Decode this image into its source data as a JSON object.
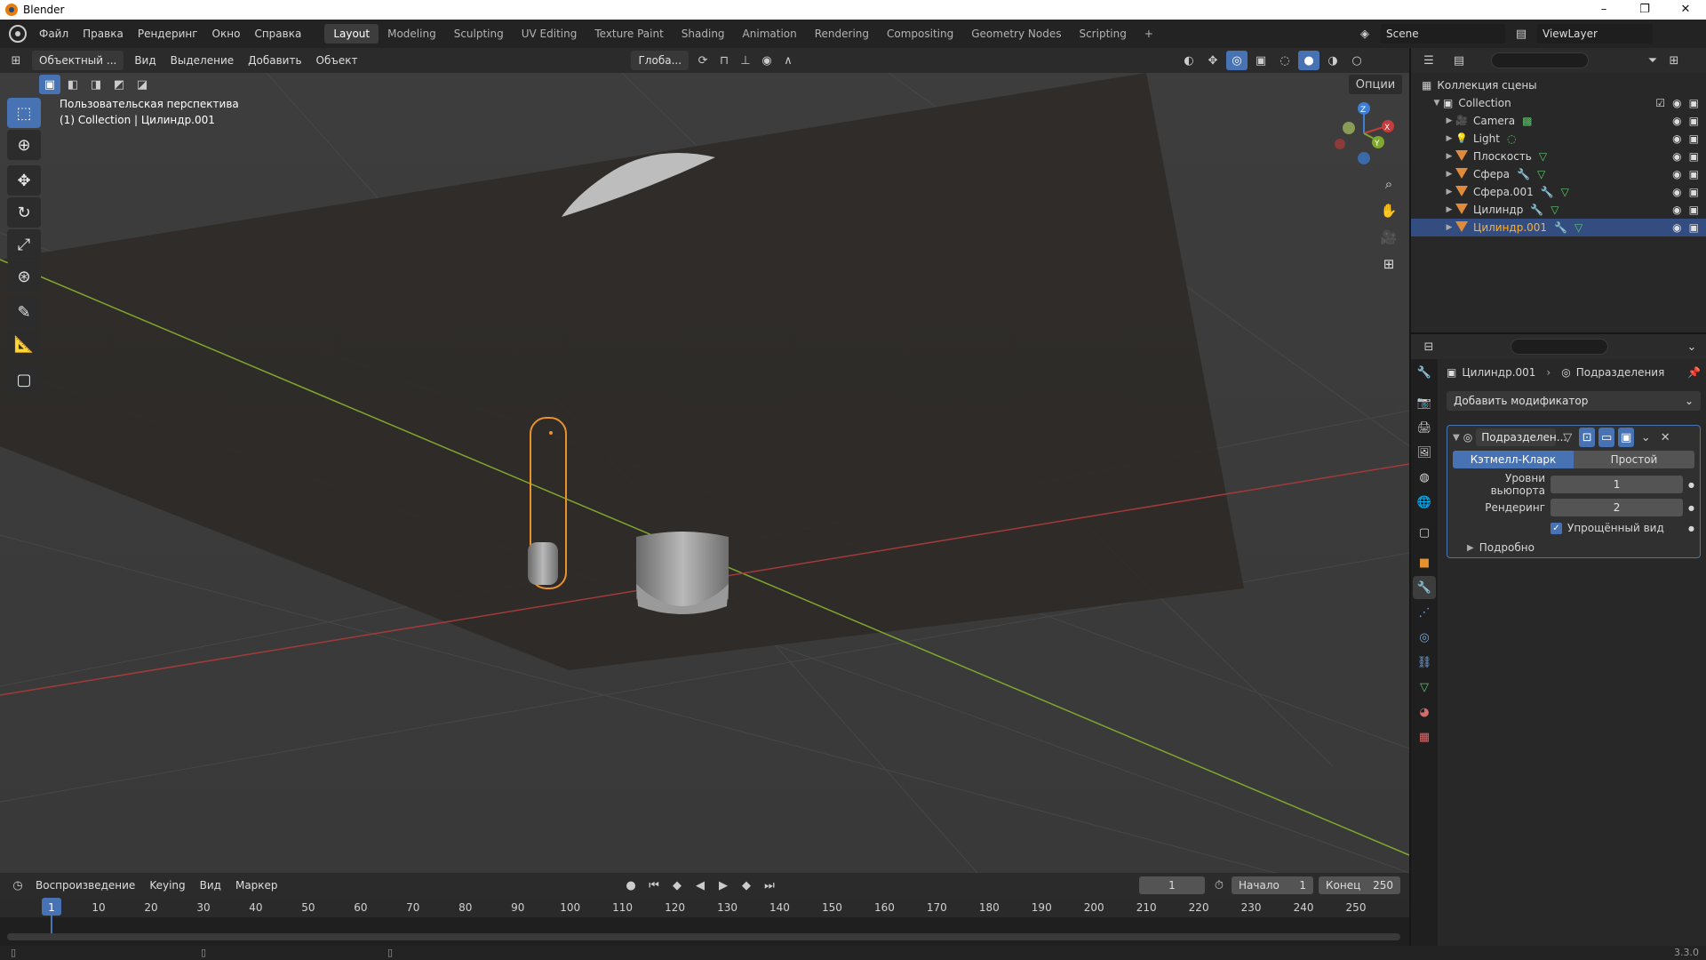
{
  "window": {
    "title": "Blender",
    "controls": [
      "–",
      "❐",
      "✕"
    ]
  },
  "menubar": {
    "items": [
      "Файл",
      "Правка",
      "Рендеринг",
      "Окно",
      "Справка"
    ],
    "workspaces": [
      "Layout",
      "Modeling",
      "Sculpting",
      "UV Editing",
      "Texture Paint",
      "Shading",
      "Animation",
      "Rendering",
      "Compositing",
      "Geometry Nodes",
      "Scripting"
    ],
    "active_workspace": "Layout",
    "add_workspace": "+",
    "scene": "Scene",
    "view_layer": "ViewLayer"
  },
  "viewport_header": {
    "mode": "Объектный ...",
    "menus": [
      "Вид",
      "Выделение",
      "Добавить",
      "Объект"
    ],
    "orientation": "Глоба...",
    "options": "Опции"
  },
  "viewport": {
    "perspective_label": "Пользовательская перспектива",
    "collection_label": "(1) Collection | Цилиндр.001",
    "gizmo_axes": {
      "x": "X",
      "y": "Y",
      "z": "Z"
    }
  },
  "tools": [
    "select-box",
    "cursor",
    "move",
    "rotate",
    "scale",
    "transform",
    "annotate",
    "measure",
    "add-cube"
  ],
  "timeline": {
    "menus": [
      "Воспроизведение",
      "Keying",
      "Вид",
      "Маркер"
    ],
    "current_frame": "1",
    "start_label": "Начало",
    "start_value": "1",
    "end_label": "Конец",
    "end_value": "250",
    "ticks": [
      "1",
      "10",
      "20",
      "30",
      "40",
      "50",
      "60",
      "70",
      "80",
      "90",
      "100",
      "110",
      "120",
      "130",
      "140",
      "150",
      "160",
      "170",
      "180",
      "190",
      "200",
      "210",
      "220",
      "230",
      "240",
      "250"
    ]
  },
  "outliner": {
    "root": "Коллекция сцены",
    "collection": "Collection",
    "items": [
      {
        "name": "Camera",
        "type": "camera"
      },
      {
        "name": "Light",
        "type": "light"
      },
      {
        "name": "Плоскость",
        "type": "mesh"
      },
      {
        "name": "Сфера",
        "type": "mesh-mod"
      },
      {
        "name": "Сфера.001",
        "type": "mesh-mod"
      },
      {
        "name": "Цилиндр",
        "type": "mesh-mod"
      },
      {
        "name": "Цилиндр.001",
        "type": "mesh-mod",
        "selected": true
      }
    ]
  },
  "properties": {
    "breadcrumb_object": "Цилиндр.001",
    "breadcrumb_modifier": "Подразделения",
    "add_modifier": "Добавить модификатор",
    "modifier": {
      "name": "Подразделен...",
      "type_options": [
        "Кэтмелл-Кларк",
        "Простой"
      ],
      "active_type": "Кэтмелл-Кларк",
      "viewport_levels_label": "Уровни вьюпорта",
      "viewport_levels": "1",
      "render_label": "Рендеринг",
      "render_levels": "2",
      "simplified_label": "Упрощённый вид",
      "simplified_checked": true,
      "advanced_label": "Подробно"
    }
  },
  "statusbar": {
    "version": "3.3.0"
  },
  "colors": {
    "accent": "#4772b3",
    "selection_outline": "#e8922e",
    "x_axis": "#c43c3c",
    "y_axis": "#7fa62e",
    "z_axis": "#3d7fd6"
  }
}
